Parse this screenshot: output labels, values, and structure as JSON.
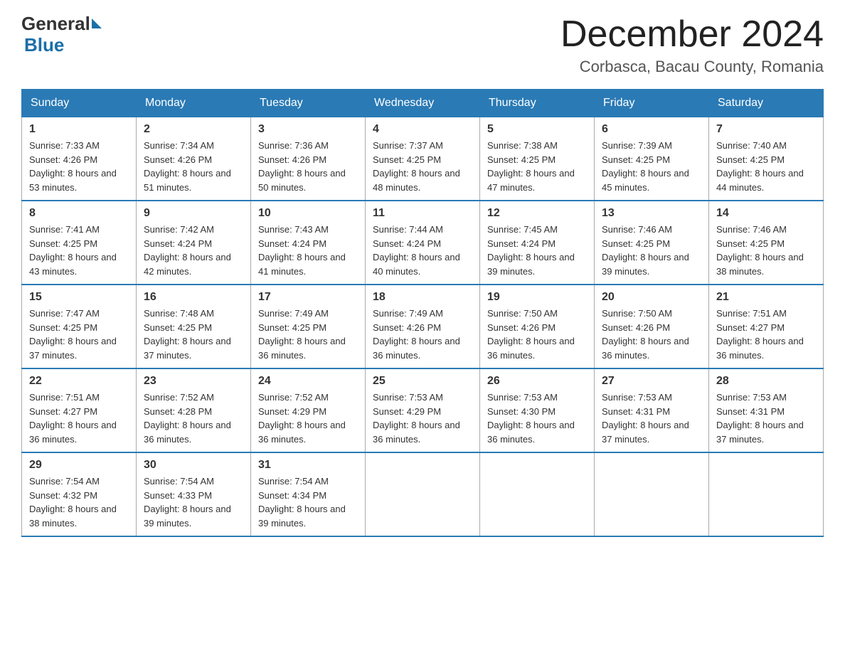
{
  "header": {
    "logo_general": "General",
    "logo_blue": "Blue",
    "title": "December 2024",
    "location": "Corbasca, Bacau County, Romania"
  },
  "columns": [
    "Sunday",
    "Monday",
    "Tuesday",
    "Wednesday",
    "Thursday",
    "Friday",
    "Saturday"
  ],
  "weeks": [
    [
      {
        "day": "1",
        "sunrise": "7:33 AM",
        "sunset": "4:26 PM",
        "daylight": "8 hours and 53 minutes."
      },
      {
        "day": "2",
        "sunrise": "7:34 AM",
        "sunset": "4:26 PM",
        "daylight": "8 hours and 51 minutes."
      },
      {
        "day": "3",
        "sunrise": "7:36 AM",
        "sunset": "4:26 PM",
        "daylight": "8 hours and 50 minutes."
      },
      {
        "day": "4",
        "sunrise": "7:37 AM",
        "sunset": "4:25 PM",
        "daylight": "8 hours and 48 minutes."
      },
      {
        "day": "5",
        "sunrise": "7:38 AM",
        "sunset": "4:25 PM",
        "daylight": "8 hours and 47 minutes."
      },
      {
        "day": "6",
        "sunrise": "7:39 AM",
        "sunset": "4:25 PM",
        "daylight": "8 hours and 45 minutes."
      },
      {
        "day": "7",
        "sunrise": "7:40 AM",
        "sunset": "4:25 PM",
        "daylight": "8 hours and 44 minutes."
      }
    ],
    [
      {
        "day": "8",
        "sunrise": "7:41 AM",
        "sunset": "4:25 PM",
        "daylight": "8 hours and 43 minutes."
      },
      {
        "day": "9",
        "sunrise": "7:42 AM",
        "sunset": "4:24 PM",
        "daylight": "8 hours and 42 minutes."
      },
      {
        "day": "10",
        "sunrise": "7:43 AM",
        "sunset": "4:24 PM",
        "daylight": "8 hours and 41 minutes."
      },
      {
        "day": "11",
        "sunrise": "7:44 AM",
        "sunset": "4:24 PM",
        "daylight": "8 hours and 40 minutes."
      },
      {
        "day": "12",
        "sunrise": "7:45 AM",
        "sunset": "4:24 PM",
        "daylight": "8 hours and 39 minutes."
      },
      {
        "day": "13",
        "sunrise": "7:46 AM",
        "sunset": "4:25 PM",
        "daylight": "8 hours and 39 minutes."
      },
      {
        "day": "14",
        "sunrise": "7:46 AM",
        "sunset": "4:25 PM",
        "daylight": "8 hours and 38 minutes."
      }
    ],
    [
      {
        "day": "15",
        "sunrise": "7:47 AM",
        "sunset": "4:25 PM",
        "daylight": "8 hours and 37 minutes."
      },
      {
        "day": "16",
        "sunrise": "7:48 AM",
        "sunset": "4:25 PM",
        "daylight": "8 hours and 37 minutes."
      },
      {
        "day": "17",
        "sunrise": "7:49 AM",
        "sunset": "4:25 PM",
        "daylight": "8 hours and 36 minutes."
      },
      {
        "day": "18",
        "sunrise": "7:49 AM",
        "sunset": "4:26 PM",
        "daylight": "8 hours and 36 minutes."
      },
      {
        "day": "19",
        "sunrise": "7:50 AM",
        "sunset": "4:26 PM",
        "daylight": "8 hours and 36 minutes."
      },
      {
        "day": "20",
        "sunrise": "7:50 AM",
        "sunset": "4:26 PM",
        "daylight": "8 hours and 36 minutes."
      },
      {
        "day": "21",
        "sunrise": "7:51 AM",
        "sunset": "4:27 PM",
        "daylight": "8 hours and 36 minutes."
      }
    ],
    [
      {
        "day": "22",
        "sunrise": "7:51 AM",
        "sunset": "4:27 PM",
        "daylight": "8 hours and 36 minutes."
      },
      {
        "day": "23",
        "sunrise": "7:52 AM",
        "sunset": "4:28 PM",
        "daylight": "8 hours and 36 minutes."
      },
      {
        "day": "24",
        "sunrise": "7:52 AM",
        "sunset": "4:29 PM",
        "daylight": "8 hours and 36 minutes."
      },
      {
        "day": "25",
        "sunrise": "7:53 AM",
        "sunset": "4:29 PM",
        "daylight": "8 hours and 36 minutes."
      },
      {
        "day": "26",
        "sunrise": "7:53 AM",
        "sunset": "4:30 PM",
        "daylight": "8 hours and 36 minutes."
      },
      {
        "day": "27",
        "sunrise": "7:53 AM",
        "sunset": "4:31 PM",
        "daylight": "8 hours and 37 minutes."
      },
      {
        "day": "28",
        "sunrise": "7:53 AM",
        "sunset": "4:31 PM",
        "daylight": "8 hours and 37 minutes."
      }
    ],
    [
      {
        "day": "29",
        "sunrise": "7:54 AM",
        "sunset": "4:32 PM",
        "daylight": "8 hours and 38 minutes."
      },
      {
        "day": "30",
        "sunrise": "7:54 AM",
        "sunset": "4:33 PM",
        "daylight": "8 hours and 39 minutes."
      },
      {
        "day": "31",
        "sunrise": "7:54 AM",
        "sunset": "4:34 PM",
        "daylight": "8 hours and 39 minutes."
      },
      null,
      null,
      null,
      null
    ]
  ]
}
